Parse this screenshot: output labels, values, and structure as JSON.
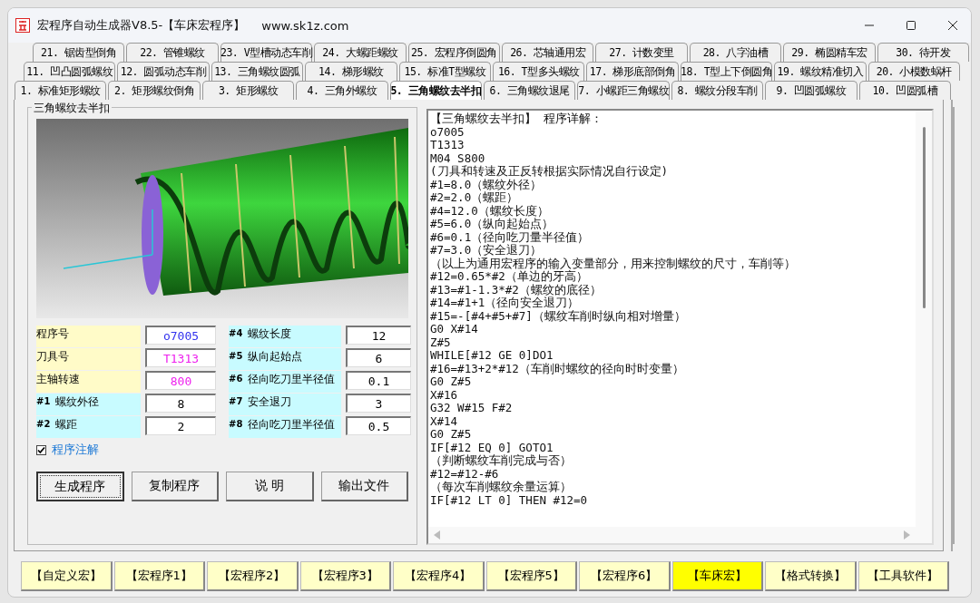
{
  "window": {
    "title": "宏程序自动生成器V8.5-【车床宏程序】",
    "url": "www.sk1z.com"
  },
  "tab_rows": [
    [
      {
        "label": "21. 锯齿型倒角",
        "selected": false
      },
      {
        "label": "22. 管锥螺纹",
        "selected": false
      },
      {
        "label": "23. V型槽动态车削",
        "selected": false
      },
      {
        "label": "24. 大螺距螺纹",
        "selected": false
      },
      {
        "label": "25. 宏程序倒圆角",
        "selected": false
      },
      {
        "label": "26. 芯轴通用宏",
        "selected": false
      },
      {
        "label": "27. 计数变里",
        "selected": false
      },
      {
        "label": "28. 八字油槽",
        "selected": false
      },
      {
        "label": "29. 椭圆精车宏",
        "selected": false
      },
      {
        "label": "30. 待开发",
        "selected": false
      }
    ],
    [
      {
        "label": "11. 凹凸圆弧螺纹",
        "selected": false
      },
      {
        "label": "12. 圆弧动态车削",
        "selected": false
      },
      {
        "label": "13. 三角螺纹圆弧",
        "selected": false
      },
      {
        "label": "14. 梯形螺纹",
        "selected": false
      },
      {
        "label": "15. 标准T型螺纹",
        "selected": false
      },
      {
        "label": "16. T型多头螺纹",
        "selected": false
      },
      {
        "label": "17. 梯形底部倒角",
        "selected": false
      },
      {
        "label": "18. T型上下倒圆角",
        "selected": false
      },
      {
        "label": "19. 螺纹精准切入",
        "selected": false
      },
      {
        "label": "20. 小模数蜗杆",
        "selected": false
      }
    ],
    [
      {
        "label": "1. 标准矩形螺纹",
        "selected": false
      },
      {
        "label": "2. 矩形螺纹倒角",
        "selected": false
      },
      {
        "label": "3. 矩形螺纹",
        "selected": false
      },
      {
        "label": "4. 三角外螺纹",
        "selected": false
      },
      {
        "label": "5. 三角螺纹去半扣",
        "selected": true
      },
      {
        "label": "6. 三角螺纹退尾",
        "selected": false
      },
      {
        "label": "7. 小螺距三角螺纹",
        "selected": false
      },
      {
        "label": "8. 螺纹分段车削",
        "selected": false
      },
      {
        "label": "9. 凹圆弧螺纹",
        "selected": false
      },
      {
        "label": "10. 凹圆弧槽",
        "selected": false
      }
    ]
  ],
  "group": {
    "title": "三角螺纹去半扣"
  },
  "fields_left": [
    {
      "kind": "general",
      "label": "程序号",
      "value": "o7005",
      "color": "#3333ee"
    },
    {
      "kind": "general",
      "label": "刀具号",
      "value": "T1313",
      "color": "#ee22ee"
    },
    {
      "kind": "general",
      "label": "主轴转速",
      "value": "800",
      "color": "#ee22ee"
    },
    {
      "kind": "variable",
      "tag": "#1",
      "label": "螺纹外径",
      "value": "8",
      "color": "#000000"
    },
    {
      "kind": "variable",
      "tag": "#2",
      "label": "螺距",
      "value": "2",
      "color": "#000000"
    }
  ],
  "fields_right": [
    {
      "kind": "variable",
      "tag": "#4",
      "label": "螺纹长度",
      "value": "12",
      "color": "#000000"
    },
    {
      "kind": "variable",
      "tag": "#5",
      "label": "纵向起始点",
      "value": "6",
      "color": "#000000"
    },
    {
      "kind": "variable",
      "tag": "#6",
      "label": "径向吃刀里半径值",
      "value": "0.1",
      "color": "#000000"
    },
    {
      "kind": "variable",
      "tag": "#7",
      "label": "安全退刀",
      "value": "3",
      "color": "#000000"
    },
    {
      "kind": "variable",
      "tag": "#8",
      "label": "径向吃刀里半径值",
      "value": "0.5",
      "color": "#000000"
    }
  ],
  "comment_checkbox": {
    "label": "程序注解",
    "checked": true
  },
  "actions": [
    {
      "label": "生成程序",
      "selected": true
    },
    {
      "label": "复制程序",
      "selected": false
    },
    {
      "label": "说 明",
      "selected": false
    },
    {
      "label": "输出文件",
      "selected": false
    }
  ],
  "code_lines": [
    "【三角螺纹去半扣】 程序详解：",
    "o7005",
    "T1313",
    "M04 S800",
    "(刀具和转速及正反转根据实际情况自行设定)",
    "#1=8.0（螺纹外径）",
    "#2=2.0（螺距）",
    "#4=12.0（螺纹长度）",
    "#5=6.0（纵向起始点）",
    "#6=0.1（径向吃刀量半径值）",
    "#7=3.0（安全退刀）",
    "（以上为通用宏程序的输入变量部分，用来控制螺纹的尺寸，车削等）",
    "#12=0.65*#2（单边的牙高）",
    "#13=#1-1.3*#2（螺纹的底径）",
    "#14=#1+1（径向安全退刀）",
    "#15=-[#4+#5+#7]（螺纹车削时纵向相对增量）",
    "G0 X#14",
    "Z#5",
    "WHILE[#12 GE 0]DO1",
    "#16=#13+2*#12（车削时螺纹的径向时时变量）",
    "G0 Z#5",
    "X#16",
    "G32 W#15 F#2",
    "X#14",
    "G0 Z#5",
    "IF[#12 EQ 0] GOTO1",
    "（判断螺纹车削完成与否）",
    "#12=#12-#6",
    "（每次车削螺纹余量运算）",
    "IF[#12 LT 0] THEN #12=0"
  ],
  "bottom_tabs": [
    {
      "label": "【自定义宏】",
      "selected": false
    },
    {
      "label": "【宏程序1】",
      "selected": false
    },
    {
      "label": "【宏程序2】",
      "selected": false
    },
    {
      "label": "【宏程序3】",
      "selected": false
    },
    {
      "label": "【宏程序4】",
      "selected": false
    },
    {
      "label": "【宏程序5】",
      "selected": false
    },
    {
      "label": "【宏程序6】",
      "selected": false
    },
    {
      "label": "【车床宏】",
      "selected": true
    },
    {
      "label": "【格式转换】",
      "selected": false
    },
    {
      "label": "【工具软件】",
      "selected": false
    }
  ]
}
